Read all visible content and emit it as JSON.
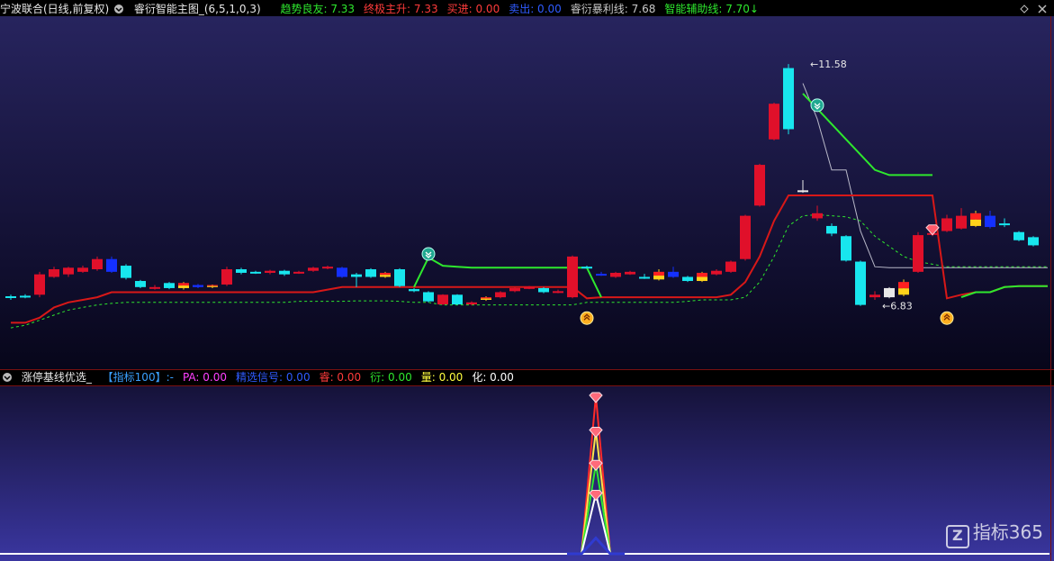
{
  "header": {
    "stock": "宁波联合(日线,前复权)",
    "indicator_name": "睿衍智能主图_(6,5,1,0,3)",
    "items": [
      {
        "label": "趋势良友: 7.33",
        "color": "#2ee82e"
      },
      {
        "label": "终极主升: 7.33",
        "color": "#ff3b3b"
      },
      {
        "label": "买进: 0.00",
        "color": "#ff3b3b"
      },
      {
        "label": "卖出: 0.00",
        "color": "#2f5bff"
      },
      {
        "label": "睿衍暴利线: 7.68",
        "color": "#c8c8c8"
      },
      {
        "label": "智能辅助线: 7.70↓",
        "color": "#2ee82e"
      }
    ]
  },
  "sub_header": {
    "name": "涨停基线优选_",
    "items": [
      {
        "label": "【指标100】:-",
        "color": "#3aa0ff"
      },
      {
        "label": "PA: 0.00",
        "color": "#ff40ff"
      },
      {
        "label": "精选信号: 0.00",
        "color": "#2f5bff"
      },
      {
        "label": "睿: 0.00",
        "color": "#ff3b3b"
      },
      {
        "label": "衍: 0.00",
        "color": "#2ee82e"
      },
      {
        "label": "量: 0.00",
        "color": "#ffff40"
      },
      {
        "label": "化: 0.00",
        "color": "#ffffff"
      }
    ]
  },
  "watermark": "指标365",
  "watermark_mark": "Z",
  "chart_data": [
    {
      "type": "candlestick",
      "ylim": [
        5.8,
        12.2
      ],
      "annotations": [
        {
          "text": "11.58",
          "index": 55,
          "value": 11.58
        },
        {
          "text": "6.83",
          "index": 60,
          "value": 6.83
        }
      ],
      "candles": [
        {
          "o": 7.0,
          "h": 7.05,
          "l": 6.95,
          "c": 7.02,
          "k": "cyan"
        },
        {
          "o": 7.02,
          "h": 7.06,
          "l": 6.98,
          "c": 7.03,
          "k": "cyan"
        },
        {
          "o": 7.05,
          "h": 7.5,
          "l": 7.0,
          "c": 7.45,
          "k": "red"
        },
        {
          "o": 7.4,
          "h": 7.6,
          "l": 7.38,
          "c": 7.55,
          "k": "red"
        },
        {
          "o": 7.45,
          "h": 7.6,
          "l": 7.4,
          "c": 7.58,
          "k": "red"
        },
        {
          "o": 7.5,
          "h": 7.62,
          "l": 7.48,
          "c": 7.58,
          "k": "red"
        },
        {
          "o": 7.55,
          "h": 7.8,
          "l": 7.52,
          "c": 7.75,
          "k": "red"
        },
        {
          "o": 7.75,
          "h": 7.8,
          "l": 7.48,
          "c": 7.5,
          "k": "blue"
        },
        {
          "o": 7.62,
          "h": 7.65,
          "l": 7.35,
          "c": 7.38,
          "k": "cyan"
        },
        {
          "o": 7.32,
          "h": 7.34,
          "l": 7.18,
          "c": 7.2,
          "k": "cyan"
        },
        {
          "o": 7.2,
          "h": 7.24,
          "l": 7.15,
          "c": 7.18,
          "k": "red"
        },
        {
          "o": 7.28,
          "h": 7.3,
          "l": 7.16,
          "c": 7.18,
          "k": "cyan"
        },
        {
          "o": 7.28,
          "h": 7.3,
          "l": 7.15,
          "c": 7.18,
          "k": "yellow"
        },
        {
          "o": 7.2,
          "h": 7.26,
          "l": 7.18,
          "c": 7.24,
          "k": "blue"
        },
        {
          "o": 7.2,
          "h": 7.25,
          "l": 7.18,
          "c": 7.24,
          "k": "yellow"
        },
        {
          "o": 7.25,
          "h": 7.6,
          "l": 7.22,
          "c": 7.55,
          "k": "red"
        },
        {
          "o": 7.55,
          "h": 7.58,
          "l": 7.45,
          "c": 7.48,
          "k": "cyan"
        },
        {
          "o": 7.5,
          "h": 7.52,
          "l": 7.46,
          "c": 7.48,
          "k": "cyan"
        },
        {
          "o": 7.48,
          "h": 7.54,
          "l": 7.45,
          "c": 7.52,
          "k": "red"
        },
        {
          "o": 7.52,
          "h": 7.54,
          "l": 7.42,
          "c": 7.45,
          "k": "cyan"
        },
        {
          "o": 7.48,
          "h": 7.52,
          "l": 7.46,
          "c": 7.5,
          "k": "red"
        },
        {
          "o": 7.52,
          "h": 7.6,
          "l": 7.5,
          "c": 7.58,
          "k": "red"
        },
        {
          "o": 7.58,
          "h": 7.62,
          "l": 7.55,
          "c": 7.6,
          "k": "red"
        },
        {
          "o": 7.58,
          "h": 7.6,
          "l": 7.38,
          "c": 7.4,
          "k": "blue"
        },
        {
          "o": 7.4,
          "h": 7.48,
          "l": 7.2,
          "c": 7.45,
          "k": "cyan"
        },
        {
          "o": 7.55,
          "h": 7.57,
          "l": 7.38,
          "c": 7.4,
          "k": "cyan"
        },
        {
          "o": 7.4,
          "h": 7.5,
          "l": 7.38,
          "c": 7.48,
          "k": "yellow"
        },
        {
          "o": 7.55,
          "h": 7.57,
          "l": 7.2,
          "c": 7.22,
          "k": "cyan"
        },
        {
          "o": 7.16,
          "h": 7.18,
          "l": 7.1,
          "c": 7.12,
          "k": "cyan"
        },
        {
          "o": 7.1,
          "h": 7.12,
          "l": 6.9,
          "c": 6.92,
          "k": "cyan"
        },
        {
          "o": 7.05,
          "h": 7.06,
          "l": 6.85,
          "c": 6.86,
          "k": "red"
        },
        {
          "o": 7.05,
          "h": 7.06,
          "l": 6.85,
          "c": 6.86,
          "k": "cyan"
        },
        {
          "o": 6.86,
          "h": 6.92,
          "l": 6.84,
          "c": 6.9,
          "k": "red"
        },
        {
          "o": 6.95,
          "h": 7.02,
          "l": 6.93,
          "c": 7.0,
          "k": "yellow"
        },
        {
          "o": 7.0,
          "h": 7.12,
          "l": 6.98,
          "c": 7.1,
          "k": "red"
        },
        {
          "o": 7.12,
          "h": 7.2,
          "l": 7.1,
          "c": 7.18,
          "k": "red"
        },
        {
          "o": 7.18,
          "h": 7.22,
          "l": 7.16,
          "c": 7.2,
          "k": "red"
        },
        {
          "o": 7.18,
          "h": 7.2,
          "l": 7.08,
          "c": 7.1,
          "k": "cyan"
        },
        {
          "o": 7.1,
          "h": 7.15,
          "l": 7.08,
          "c": 7.12,
          "k": "red"
        },
        {
          "o": 7.0,
          "h": 7.82,
          "l": 6.98,
          "c": 7.8,
          "k": "red"
        },
        {
          "o": 7.6,
          "h": 7.62,
          "l": 7.58,
          "c": 7.6,
          "k": "cyan"
        },
        {
          "o": 7.45,
          "h": 7.5,
          "l": 7.42,
          "c": 7.46,
          "k": "blue"
        },
        {
          "o": 7.4,
          "h": 7.5,
          "l": 7.38,
          "c": 7.48,
          "k": "red"
        },
        {
          "o": 7.45,
          "h": 7.52,
          "l": 7.44,
          "c": 7.5,
          "k": "red"
        },
        {
          "o": 7.38,
          "h": 7.46,
          "l": 7.36,
          "c": 7.4,
          "k": "cyan"
        },
        {
          "o": 7.35,
          "h": 7.55,
          "l": 7.33,
          "c": 7.5,
          "k": "yellow"
        },
        {
          "o": 7.5,
          "h": 7.6,
          "l": 7.38,
          "c": 7.4,
          "k": "blue"
        },
        {
          "o": 7.4,
          "h": 7.42,
          "l": 7.3,
          "c": 7.32,
          "k": "cyan"
        },
        {
          "o": 7.32,
          "h": 7.5,
          "l": 7.3,
          "c": 7.48,
          "k": "yellow"
        },
        {
          "o": 7.45,
          "h": 7.55,
          "l": 7.43,
          "c": 7.52,
          "k": "red"
        },
        {
          "o": 7.5,
          "h": 7.72,
          "l": 7.48,
          "c": 7.7,
          "k": "red"
        },
        {
          "o": 7.75,
          "h": 8.62,
          "l": 7.72,
          "c": 8.6,
          "k": "red"
        },
        {
          "o": 8.8,
          "h": 9.62,
          "l": 8.78,
          "c": 9.6,
          "k": "red"
        },
        {
          "o": 10.1,
          "h": 10.82,
          "l": 10.08,
          "c": 10.8,
          "k": "red"
        },
        {
          "o": 10.3,
          "h": 11.58,
          "l": 10.2,
          "c": 11.5,
          "k": "cyan"
        },
        {
          "o": 9.1,
          "h": 9.3,
          "l": 9.05,
          "c": 9.1,
          "k": "white"
        },
        {
          "o": 8.65,
          "h": 8.8,
          "l": 8.5,
          "c": 8.55,
          "k": "red"
        },
        {
          "o": 8.4,
          "h": 8.45,
          "l": 8.2,
          "c": 8.25,
          "k": "cyan"
        },
        {
          "o": 8.2,
          "h": 8.22,
          "l": 7.7,
          "c": 7.72,
          "k": "cyan"
        },
        {
          "o": 7.7,
          "h": 7.72,
          "l": 6.83,
          "c": 6.85,
          "k": "cyan"
        },
        {
          "o": 7.05,
          "h": 7.12,
          "l": 6.95,
          "c": 7.0,
          "k": "red"
        },
        {
          "o": 7.0,
          "h": 7.2,
          "l": 6.98,
          "c": 7.18,
          "k": "white"
        },
        {
          "o": 7.05,
          "h": 7.35,
          "l": 7.02,
          "c": 7.3,
          "k": "yellow"
        },
        {
          "o": 7.5,
          "h": 8.28,
          "l": 7.48,
          "c": 8.22,
          "k": "red"
        },
        {
          "o": 8.25,
          "h": 8.28,
          "l": 8.2,
          "c": 8.26,
          "k": "red"
        },
        {
          "o": 8.3,
          "h": 8.62,
          "l": 8.28,
          "c": 8.55,
          "k": "red"
        },
        {
          "o": 8.35,
          "h": 8.75,
          "l": 8.33,
          "c": 8.6,
          "k": "red"
        },
        {
          "o": 8.4,
          "h": 8.7,
          "l": 8.38,
          "c": 8.65,
          "k": "yellow"
        },
        {
          "o": 8.6,
          "h": 8.7,
          "l": 8.35,
          "c": 8.38,
          "k": "blue"
        },
        {
          "o": 8.45,
          "h": 8.55,
          "l": 8.38,
          "c": 8.42,
          "k": "cyan"
        },
        {
          "o": 8.28,
          "h": 8.3,
          "l": 8.1,
          "c": 8.12,
          "k": "cyan"
        },
        {
          "o": 8.18,
          "h": 8.2,
          "l": 8.0,
          "c": 8.02,
          "k": "cyan"
        }
      ],
      "lines": {
        "red": [
          6.5,
          6.5,
          6.6,
          6.8,
          6.9,
          6.95,
          7.0,
          7.1,
          7.1,
          7.1,
          7.1,
          7.1,
          7.1,
          7.1,
          7.1,
          7.1,
          7.1,
          7.1,
          7.1,
          7.1,
          7.1,
          7.1,
          7.15,
          7.2,
          7.2,
          7.2,
          7.2,
          7.2,
          7.2,
          7.2,
          7.2,
          7.2,
          7.2,
          7.2,
          7.2,
          7.2,
          7.2,
          7.2,
          7.2,
          7.2,
          6.98,
          7.0,
          7.0,
          7.0,
          7.0,
          7.0,
          7.0,
          7.0,
          7.0,
          7.0,
          7.05,
          7.3,
          7.8,
          8.5,
          9.0,
          9.0,
          9.0,
          9.0,
          9.0,
          9.0,
          9.0,
          9.0,
          9.0,
          9.0,
          9.0,
          6.98,
          7.05,
          7.1,
          7.1,
          7.2,
          7.22,
          7.22,
          7.22
        ],
        "green": [
          null,
          null,
          null,
          null,
          null,
          null,
          null,
          null,
          null,
          null,
          null,
          null,
          null,
          null,
          null,
          null,
          null,
          null,
          null,
          null,
          null,
          null,
          null,
          null,
          null,
          null,
          null,
          null,
          7.2,
          7.78,
          7.62,
          7.6,
          7.58,
          7.58,
          7.58,
          7.58,
          7.58,
          7.58,
          7.58,
          7.58,
          7.58,
          7.0,
          null,
          null,
          null,
          null,
          null,
          null,
          null,
          null,
          null,
          null,
          null,
          null,
          null,
          11.0,
          10.7,
          10.4,
          10.1,
          9.8,
          9.5,
          9.4,
          9.4,
          9.4,
          9.4,
          null,
          7.0,
          7.1,
          7.1,
          7.2,
          7.22,
          7.22,
          7.22
        ],
        "dashed": [
          6.4,
          6.45,
          6.55,
          6.65,
          6.75,
          6.8,
          6.85,
          6.88,
          6.9,
          6.9,
          6.9,
          6.9,
          6.9,
          6.9,
          6.9,
          6.9,
          6.9,
          6.9,
          6.9,
          6.9,
          6.92,
          6.92,
          6.92,
          6.92,
          6.93,
          6.93,
          6.93,
          6.92,
          6.9,
          6.9,
          6.85,
          6.85,
          6.85,
          6.85,
          6.85,
          6.85,
          6.85,
          6.85,
          6.85,
          6.85,
          6.9,
          6.9,
          6.9,
          6.9,
          6.9,
          6.9,
          6.9,
          6.92,
          6.95,
          6.95,
          6.95,
          7.0,
          7.3,
          7.8,
          8.4,
          8.6,
          8.62,
          8.6,
          8.58,
          8.5,
          8.2,
          8.0,
          7.8,
          7.7,
          7.65,
          7.6,
          7.6,
          7.6,
          7.6,
          7.6,
          7.6,
          7.6,
          7.6
        ],
        "gray": [
          null,
          null,
          null,
          null,
          null,
          null,
          null,
          null,
          null,
          null,
          null,
          null,
          null,
          null,
          null,
          null,
          null,
          null,
          null,
          null,
          null,
          null,
          null,
          null,
          null,
          null,
          null,
          null,
          null,
          null,
          null,
          null,
          null,
          null,
          null,
          null,
          null,
          null,
          null,
          null,
          null,
          null,
          null,
          null,
          null,
          null,
          null,
          null,
          null,
          null,
          null,
          null,
          null,
          null,
          null,
          11.2,
          10.5,
          9.5,
          9.5,
          8.3,
          7.6,
          7.58,
          7.58,
          7.58,
          7.58,
          7.58,
          7.58,
          7.58,
          7.58,
          7.58,
          7.58,
          7.58,
          7.58
        ]
      },
      "signals": [
        {
          "index": 29,
          "type": "sell-green"
        },
        {
          "index": 40,
          "type": "buy-orange"
        },
        {
          "index": 56,
          "type": "sell-green"
        },
        {
          "index": 65,
          "type": "buy-orange"
        },
        {
          "index": 64,
          "type": "gem-red"
        }
      ]
    },
    {
      "type": "area",
      "ylim": [
        0,
        100
      ],
      "x": [
        38,
        39,
        40,
        41,
        42
      ],
      "series": [
        {
          "values": [
            0,
            0,
            100,
            0,
            0
          ],
          "color": "#ff2a2a"
        },
        {
          "values": [
            0,
            0,
            78,
            0,
            0
          ],
          "color": "#ffe14a"
        },
        {
          "values": [
            0,
            0,
            57,
            0,
            0
          ],
          "color": "#2ee82e"
        },
        {
          "values": [
            0,
            0,
            38,
            0,
            0
          ],
          "color": "#ffffff"
        },
        {
          "values": [
            0,
            0,
            10,
            0,
            0
          ],
          "color": "#2f3bd0"
        }
      ],
      "gems_at": [
        100,
        78,
        57,
        38
      ]
    }
  ]
}
